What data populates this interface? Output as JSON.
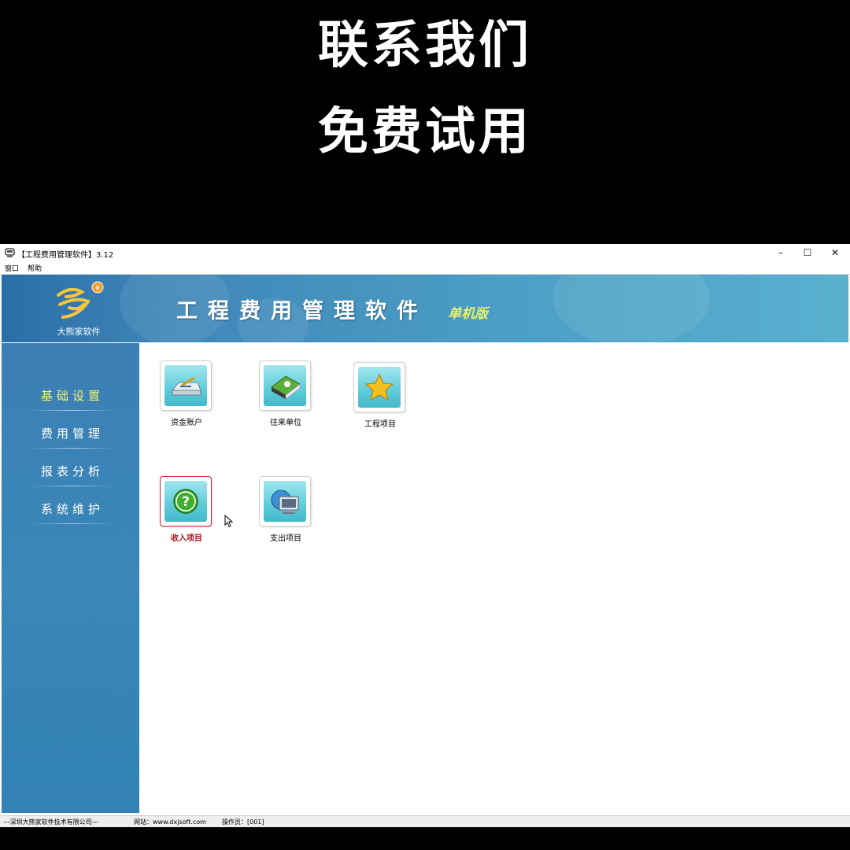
{
  "promo": {
    "line1": "联系我们",
    "line2": "免费试用"
  },
  "window": {
    "title": "【工程费用管理软件】3.12",
    "controls": {
      "minimize": "–",
      "maximize": "☐",
      "close": "✕"
    }
  },
  "menu": {
    "items": [
      {
        "label": "窗口"
      },
      {
        "label": "帮助"
      }
    ]
  },
  "banner": {
    "logo_text": "大熊家软件",
    "title": "工程费用管理软件",
    "edition": "单机版"
  },
  "sidebar": {
    "items": [
      {
        "label": "基础设置",
        "active": true
      },
      {
        "label": "费用管理"
      },
      {
        "label": "报表分析"
      },
      {
        "label": "系统维护"
      }
    ]
  },
  "tiles": [
    {
      "label": "资金账户",
      "icon": "money-tray-icon"
    },
    {
      "label": "往来单位",
      "icon": "contacts-book-icon"
    },
    {
      "label": "工程项目",
      "icon": "star-icon"
    },
    {
      "label": "收入项目",
      "icon": "help-question-icon",
      "selected": true
    },
    {
      "label": "支出项目",
      "icon": "computer-globe-icon"
    }
  ],
  "statusbar": {
    "company": "---深圳大熊家软件技术有限公司---",
    "website": "网站：www.dxjsoft.com",
    "operator": "操作员：[001]"
  },
  "colors": {
    "banner": "#4a9cc4",
    "sidebar": "#3a87b8",
    "active_menu": "#f2f36a",
    "selected_tile": "#c8283a",
    "edition": "#e8f06a"
  }
}
